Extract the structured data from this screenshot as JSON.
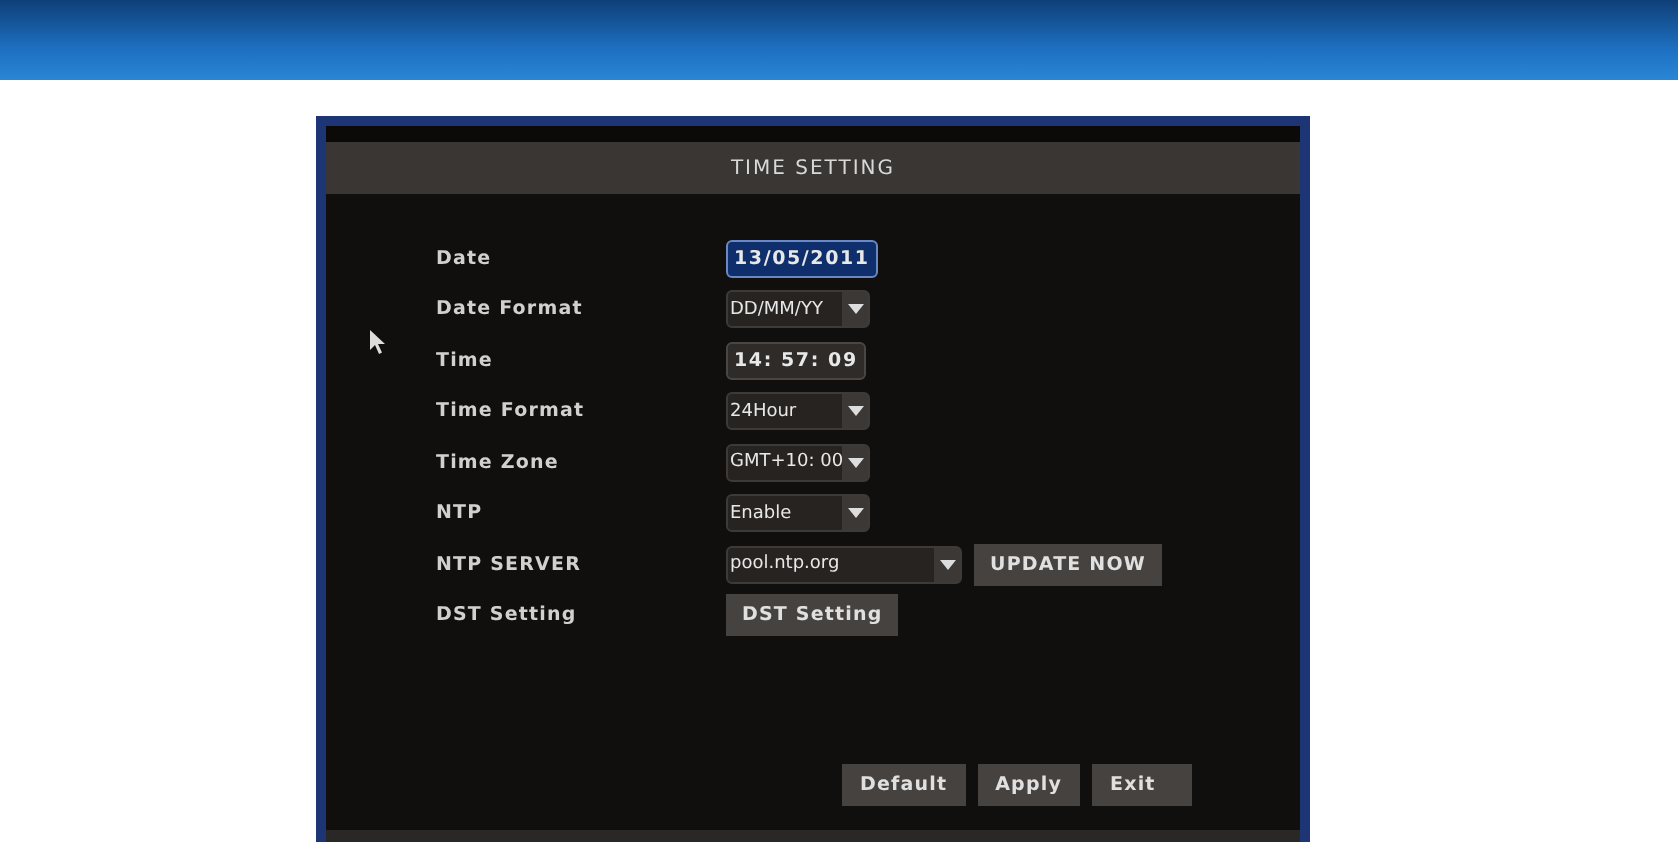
{
  "title": "TIME SETTING",
  "rows": [
    {
      "label": "Date",
      "kind": "field",
      "value": "13/05/2011",
      "focused": true
    },
    {
      "label": "Date Format",
      "kind": "dropdown",
      "value": "DD/MM/YY"
    },
    {
      "label": "Time",
      "kind": "field",
      "value": "14: 57: 09",
      "focused": false
    },
    {
      "label": "Time Format",
      "kind": "dropdown",
      "value": "24Hour"
    },
    {
      "label": "Time Zone",
      "kind": "dropdown",
      "value": "GMT+10: 00"
    },
    {
      "label": "NTP",
      "kind": "dropdown",
      "value": "Enable"
    },
    {
      "label": "NTP SERVER",
      "kind": "wide-dropdown",
      "value": "pool.ntp.org",
      "action": "UPDATE NOW"
    },
    {
      "label": "DST Setting",
      "kind": "button",
      "value": "DST Setting"
    }
  ],
  "buttons": [
    "Default",
    "Apply",
    "Exit"
  ]
}
